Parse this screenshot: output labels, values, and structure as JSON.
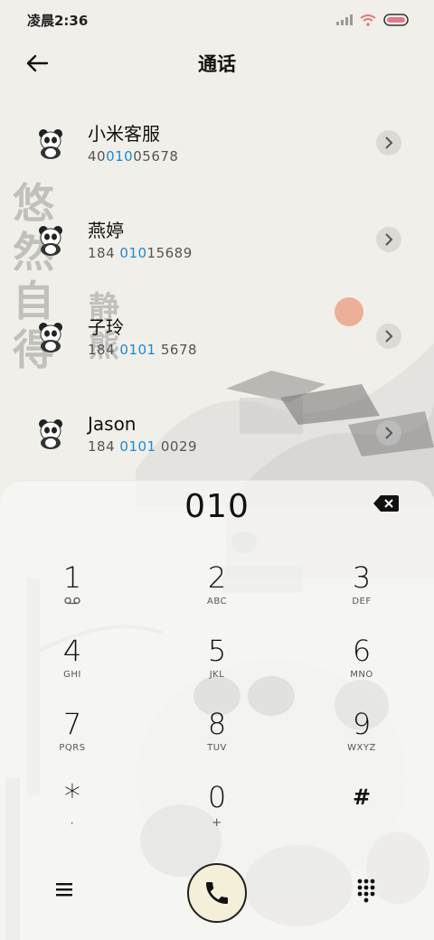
{
  "status_bar": {
    "time": "凌晨2:36",
    "icons": [
      "signal-icon",
      "wifi-icon",
      "battery-icon"
    ]
  },
  "header": {
    "title": "通话",
    "back_icon": "back-arrow-icon"
  },
  "contacts": [
    {
      "name": "小米客服",
      "number_pre": "40",
      "number_hl": "010",
      "number_post": "05678"
    },
    {
      "name": "燕婷",
      "number_pre": "184 ",
      "number_hl": "010",
      "number_post": "15689"
    },
    {
      "name": "子玲",
      "number_pre": "184 ",
      "number_hl": "0101",
      "number_post": " 5678"
    },
    {
      "name": "Jason",
      "number_pre": "184 ",
      "number_hl": "0101",
      "number_post": " 0029"
    }
  ],
  "dialer": {
    "display": "010",
    "keys": [
      {
        "digit": "1",
        "letters": "ᴑᴑ"
      },
      {
        "digit": "2",
        "letters": "ABC"
      },
      {
        "digit": "3",
        "letters": "DEF"
      },
      {
        "digit": "4",
        "letters": "GHI"
      },
      {
        "digit": "5",
        "letters": "JKL"
      },
      {
        "digit": "6",
        "letters": "MNO"
      },
      {
        "digit": "7",
        "letters": "PQRS"
      },
      {
        "digit": "8",
        "letters": "TUV"
      },
      {
        "digit": "9",
        "letters": "WXYZ"
      },
      {
        "digit": "*",
        "letters": ","
      },
      {
        "digit": "0",
        "letters": "+"
      },
      {
        "digit": "#",
        "letters": ""
      }
    ]
  },
  "background_text": {
    "left_column": "悠然自得",
    "middle_column": "静熊"
  },
  "colors": {
    "highlight": "#1a8ad6",
    "background": "#f1efe9",
    "call_button": "#f3efd9"
  }
}
